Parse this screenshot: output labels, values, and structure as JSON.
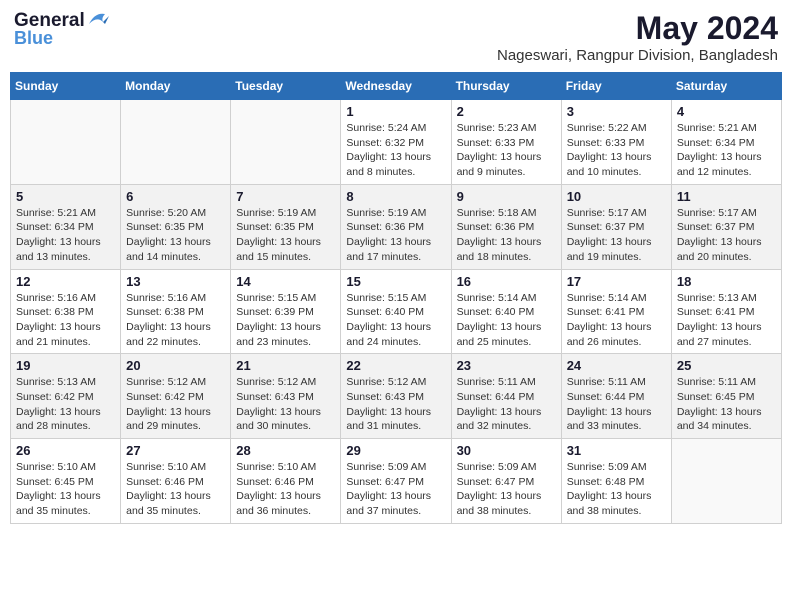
{
  "header": {
    "logo_general": "General",
    "logo_blue": "Blue",
    "month_year": "May 2024",
    "location": "Nageswari, Rangpur Division, Bangladesh"
  },
  "weekdays": [
    "Sunday",
    "Monday",
    "Tuesday",
    "Wednesday",
    "Thursday",
    "Friday",
    "Saturday"
  ],
  "weeks": [
    {
      "shaded": false,
      "days": [
        {
          "num": "",
          "info": ""
        },
        {
          "num": "",
          "info": ""
        },
        {
          "num": "",
          "info": ""
        },
        {
          "num": "1",
          "info": "Sunrise: 5:24 AM\nSunset: 6:32 PM\nDaylight: 13 hours\nand 8 minutes."
        },
        {
          "num": "2",
          "info": "Sunrise: 5:23 AM\nSunset: 6:33 PM\nDaylight: 13 hours\nand 9 minutes."
        },
        {
          "num": "3",
          "info": "Sunrise: 5:22 AM\nSunset: 6:33 PM\nDaylight: 13 hours\nand 10 minutes."
        },
        {
          "num": "4",
          "info": "Sunrise: 5:21 AM\nSunset: 6:34 PM\nDaylight: 13 hours\nand 12 minutes."
        }
      ]
    },
    {
      "shaded": true,
      "days": [
        {
          "num": "5",
          "info": "Sunrise: 5:21 AM\nSunset: 6:34 PM\nDaylight: 13 hours\nand 13 minutes."
        },
        {
          "num": "6",
          "info": "Sunrise: 5:20 AM\nSunset: 6:35 PM\nDaylight: 13 hours\nand 14 minutes."
        },
        {
          "num": "7",
          "info": "Sunrise: 5:19 AM\nSunset: 6:35 PM\nDaylight: 13 hours\nand 15 minutes."
        },
        {
          "num": "8",
          "info": "Sunrise: 5:19 AM\nSunset: 6:36 PM\nDaylight: 13 hours\nand 17 minutes."
        },
        {
          "num": "9",
          "info": "Sunrise: 5:18 AM\nSunset: 6:36 PM\nDaylight: 13 hours\nand 18 minutes."
        },
        {
          "num": "10",
          "info": "Sunrise: 5:17 AM\nSunset: 6:37 PM\nDaylight: 13 hours\nand 19 minutes."
        },
        {
          "num": "11",
          "info": "Sunrise: 5:17 AM\nSunset: 6:37 PM\nDaylight: 13 hours\nand 20 minutes."
        }
      ]
    },
    {
      "shaded": false,
      "days": [
        {
          "num": "12",
          "info": "Sunrise: 5:16 AM\nSunset: 6:38 PM\nDaylight: 13 hours\nand 21 minutes."
        },
        {
          "num": "13",
          "info": "Sunrise: 5:16 AM\nSunset: 6:38 PM\nDaylight: 13 hours\nand 22 minutes."
        },
        {
          "num": "14",
          "info": "Sunrise: 5:15 AM\nSunset: 6:39 PM\nDaylight: 13 hours\nand 23 minutes."
        },
        {
          "num": "15",
          "info": "Sunrise: 5:15 AM\nSunset: 6:40 PM\nDaylight: 13 hours\nand 24 minutes."
        },
        {
          "num": "16",
          "info": "Sunrise: 5:14 AM\nSunset: 6:40 PM\nDaylight: 13 hours\nand 25 minutes."
        },
        {
          "num": "17",
          "info": "Sunrise: 5:14 AM\nSunset: 6:41 PM\nDaylight: 13 hours\nand 26 minutes."
        },
        {
          "num": "18",
          "info": "Sunrise: 5:13 AM\nSunset: 6:41 PM\nDaylight: 13 hours\nand 27 minutes."
        }
      ]
    },
    {
      "shaded": true,
      "days": [
        {
          "num": "19",
          "info": "Sunrise: 5:13 AM\nSunset: 6:42 PM\nDaylight: 13 hours\nand 28 minutes."
        },
        {
          "num": "20",
          "info": "Sunrise: 5:12 AM\nSunset: 6:42 PM\nDaylight: 13 hours\nand 29 minutes."
        },
        {
          "num": "21",
          "info": "Sunrise: 5:12 AM\nSunset: 6:43 PM\nDaylight: 13 hours\nand 30 minutes."
        },
        {
          "num": "22",
          "info": "Sunrise: 5:12 AM\nSunset: 6:43 PM\nDaylight: 13 hours\nand 31 minutes."
        },
        {
          "num": "23",
          "info": "Sunrise: 5:11 AM\nSunset: 6:44 PM\nDaylight: 13 hours\nand 32 minutes."
        },
        {
          "num": "24",
          "info": "Sunrise: 5:11 AM\nSunset: 6:44 PM\nDaylight: 13 hours\nand 33 minutes."
        },
        {
          "num": "25",
          "info": "Sunrise: 5:11 AM\nSunset: 6:45 PM\nDaylight: 13 hours\nand 34 minutes."
        }
      ]
    },
    {
      "shaded": false,
      "days": [
        {
          "num": "26",
          "info": "Sunrise: 5:10 AM\nSunset: 6:45 PM\nDaylight: 13 hours\nand 35 minutes."
        },
        {
          "num": "27",
          "info": "Sunrise: 5:10 AM\nSunset: 6:46 PM\nDaylight: 13 hours\nand 35 minutes."
        },
        {
          "num": "28",
          "info": "Sunrise: 5:10 AM\nSunset: 6:46 PM\nDaylight: 13 hours\nand 36 minutes."
        },
        {
          "num": "29",
          "info": "Sunrise: 5:09 AM\nSunset: 6:47 PM\nDaylight: 13 hours\nand 37 minutes."
        },
        {
          "num": "30",
          "info": "Sunrise: 5:09 AM\nSunset: 6:47 PM\nDaylight: 13 hours\nand 38 minutes."
        },
        {
          "num": "31",
          "info": "Sunrise: 5:09 AM\nSunset: 6:48 PM\nDaylight: 13 hours\nand 38 minutes."
        },
        {
          "num": "",
          "info": ""
        }
      ]
    }
  ]
}
